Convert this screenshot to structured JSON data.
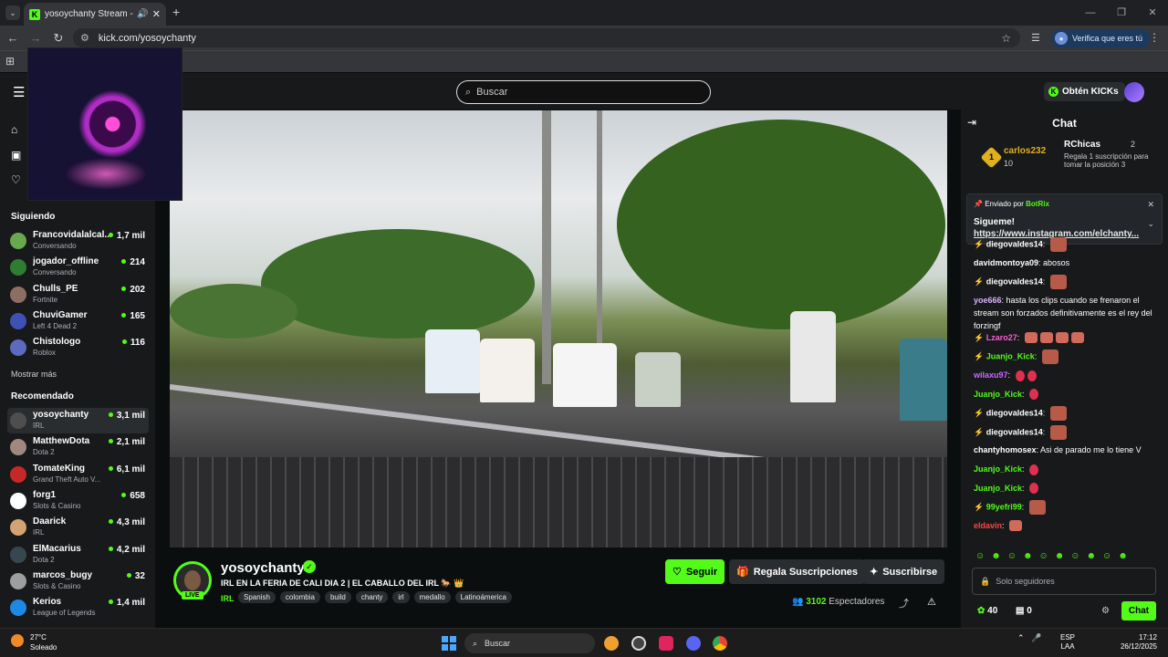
{
  "browser": {
    "tab_title": "yosoychanty Stream - Watch Live on Kick",
    "url": "kick.com/yosoychanty",
    "verify_label": "Verifica que eres tú",
    "new_tab": "+",
    "close": "✕"
  },
  "header": {
    "search_placeholder": "Buscar",
    "get_kicks": "Obtén KICKs"
  },
  "sidebar": {
    "following_title": "Siguiendo",
    "show_more": "Mostrar más",
    "recommended_title": "Recomendado",
    "following": [
      {
        "name": "Francovidalalcal...",
        "category": "Conversando",
        "viewers": "1,7 mil",
        "color": "#6aa84f"
      },
      {
        "name": "jogador_offline",
        "category": "Conversando",
        "viewers": "214",
        "color": "#2e7d32"
      },
      {
        "name": "Chulls_PE",
        "category": "Fortnite",
        "viewers": "202",
        "color": "#8d6e63"
      },
      {
        "name": "ChuviGamer",
        "category": "Left 4 Dead 2",
        "viewers": "165",
        "color": "#3f51b5"
      },
      {
        "name": "Chistologo",
        "category": "Roblox",
        "viewers": "116",
        "color": "#5c6bc0"
      }
    ],
    "recommended": [
      {
        "name": "yosoychanty",
        "category": "IRL",
        "viewers": "3,1 mil",
        "color": "#4e4e4e"
      },
      {
        "name": "MatthewDota",
        "category": "Dota 2",
        "viewers": "2,1 mil",
        "color": "#a1887f"
      },
      {
        "name": "TomateKing",
        "category": "Grand Theft Auto V...",
        "viewers": "6,1 mil",
        "color": "#c62828"
      },
      {
        "name": "forg1",
        "category": "Slots & Casino",
        "viewers": "658",
        "color": "#ffffff"
      },
      {
        "name": "Daarick",
        "category": "IRL",
        "viewers": "4,3 mil",
        "color": "#d4a373"
      },
      {
        "name": "ElMacarius",
        "category": "Dota 2",
        "viewers": "4,2 mil",
        "color": "#37474f"
      },
      {
        "name": "marcos_bugy",
        "category": "Slots & Casino",
        "viewers": "32",
        "color": "#9e9e9e"
      },
      {
        "name": "Kerios",
        "category": "League of Legends",
        "viewers": "1,4 mil",
        "color": "#1e88e5"
      }
    ]
  },
  "stream": {
    "channel": "yosoychanty",
    "live": "LIVE",
    "title": "IRL EN LA FERIA DE CALI DIA 2 | EL CABALLO DEL IRL 🐎 👑",
    "category": "IRL",
    "tags": [
      "Spanish",
      "colombia",
      "build",
      "chanty",
      "irl",
      "medallo",
      "Latinoámerica"
    ],
    "follow": "Seguir",
    "gift_subs": "Regala Suscripciones",
    "subscribe": "Suscribirse",
    "viewers_count": "3102",
    "viewers_label": "Espectadores"
  },
  "chat": {
    "title": "Chat",
    "leader": {
      "rank": "1",
      "user": "carlos232",
      "count": "10"
    },
    "gifter": {
      "user": "RChicas",
      "count": "2",
      "text": "Regala 1 suscripción para tomar la posición 3"
    },
    "pinned": {
      "by": "Enviado por",
      "bot": "BotRix",
      "line1": "Sigueme!",
      "line2": "https://www.instagram.com/elchanty..."
    },
    "messages": [
      {
        "user": "diegovaldes14",
        "text": "",
        "color": "#ffffff",
        "emote": "big"
      },
      {
        "user": "davidmontoya09",
        "text": "abosos",
        "color": "#ffffff",
        "emote": ""
      },
      {
        "user": "diegovaldes14",
        "text": "",
        "color": "#ffffff",
        "emote": "big"
      },
      {
        "user": "yoe666",
        "text": "hasta los clips cuando se frenaron el stream son forzados definitivamente es el rey del forzingf",
        "color": "#d9b3ff",
        "emote": ""
      },
      {
        "user": "Lzaro27",
        "text": "",
        "color": "#ff5bd8",
        "emote": "hands"
      },
      {
        "user": "Juanjo_Kick",
        "text": "",
        "color": "#53fc18",
        "emote": "big"
      },
      {
        "user": "wilaxu97",
        "text": "",
        "color": "#c76bff",
        "emote": "red2"
      },
      {
        "user": "Juanjo_Kick",
        "text": "",
        "color": "#53fc18",
        "emote": "red"
      },
      {
        "user": "diegovaldes14",
        "text": "",
        "color": "#ffffff",
        "emote": "big"
      },
      {
        "user": "diegovaldes14",
        "text": "",
        "color": "#ffffff",
        "emote": "big"
      },
      {
        "user": "chantyhomosex",
        "text": "Asi de parado me lo tiene V",
        "color": "#ffffff",
        "emote": ""
      },
      {
        "user": "Juanjo_Kick",
        "text": "",
        "color": "#53fc18",
        "emote": "red"
      },
      {
        "user": "Juanjo_Kick",
        "text": "",
        "color": "#53fc18",
        "emote": "red"
      },
      {
        "user": "99yefri99",
        "text": "",
        "color": "#53fc18",
        "emote": "big"
      },
      {
        "user": "eldavin",
        "text": "",
        "color": "#ff4444",
        "emote": "small"
      }
    ],
    "input_placeholder": "Solo seguidores",
    "points": "40",
    "drops": "0",
    "send": "Chat"
  },
  "taskbar": {
    "temp": "27°C",
    "weather": "Soleado",
    "search": "Buscar",
    "lang1": "ESP",
    "lang2": "LAA",
    "time": "17:12",
    "date": "26/12/2025"
  },
  "colors": {
    "accent": "#53fc18",
    "bg": "#0b0e0f",
    "panel": "#18191b"
  }
}
